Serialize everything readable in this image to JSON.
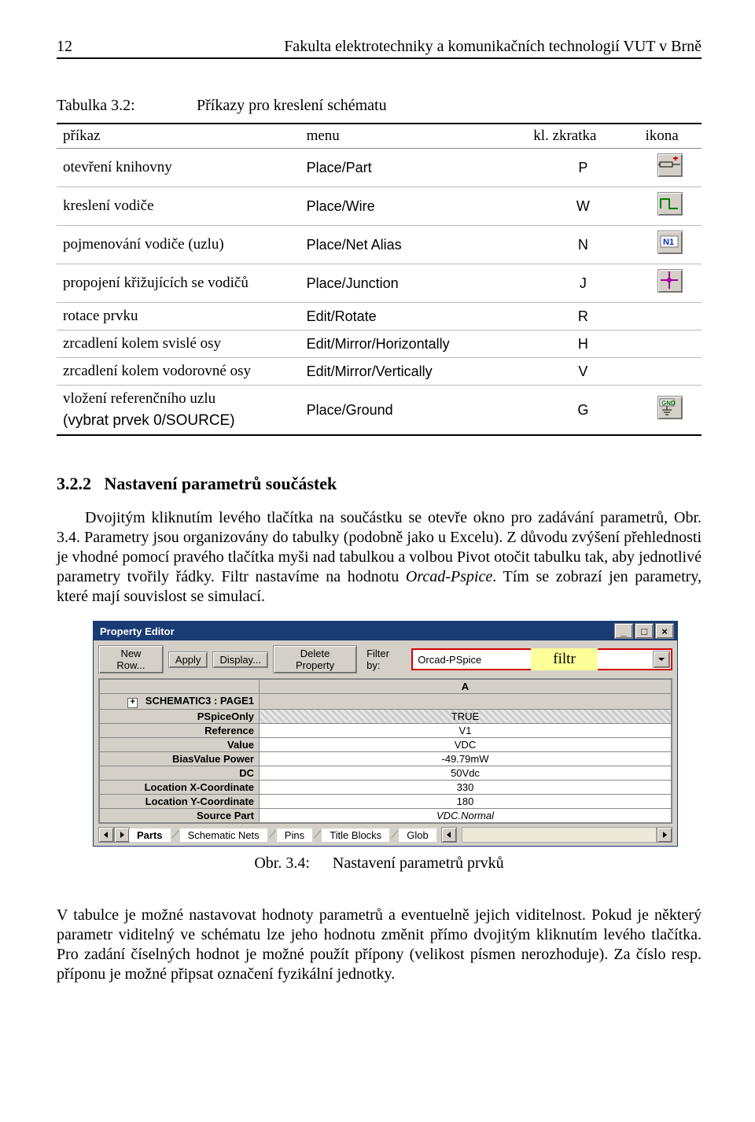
{
  "header": {
    "page": "12",
    "title": "Fakulta elektrotechniky a komunikačních technologií VUT v Brně"
  },
  "tablecaption": {
    "number": "Tabulka 3.2:",
    "text": "Příkazy pro kreslení schématu"
  },
  "tablehead": {
    "c1": "příkaz",
    "c2": "menu",
    "c3": "kl. zkratka",
    "c4": "ikona"
  },
  "rows": [
    {
      "prikaz": "otevření knihovny",
      "menu": "Place/Part",
      "zk": "P",
      "icon": "part"
    },
    {
      "prikaz": "kreslení vodiče",
      "menu": "Place/Wire",
      "zk": "W",
      "icon": "wire"
    },
    {
      "prikaz": "pojmenování vodiče (uzlu)",
      "menu": "Place/Net Alias",
      "zk": "N",
      "icon": "netalias"
    },
    {
      "prikaz": "propojení křižujících se vodičů",
      "menu": "Place/Junction",
      "zk": "J",
      "icon": "junction"
    },
    {
      "prikaz": "rotace prvku",
      "menu": "Edit/Rotate",
      "zk": "R",
      "icon": ""
    },
    {
      "prikaz": "zrcadlení kolem svislé osy",
      "menu": "Edit/Mirror/Horizontally",
      "zk": "H",
      "icon": ""
    },
    {
      "prikaz": "zrcadlení kolem vodorovné osy",
      "menu": "Edit/Mirror/Vertically",
      "zk": "V",
      "icon": ""
    },
    {
      "prikaz": "vložení referenčního uzlu",
      "menu": "Place/Ground",
      "zk": "G",
      "icon": "ground"
    }
  ],
  "source_note": "(vybrat prvek 0/SOURCE)",
  "section": {
    "number": "3.2.2",
    "title": "Nastavení parametrů součástek"
  },
  "para1": "Dvojitým kliknutím levého tlačítka na součástku se otevře okno pro zadávání parametrů, Obr. 3.4. Parametry jsou organizovány do tabulky (podobně jako u Excelu). Z důvodu zvýšení přehlednosti je vhodné pomocí pravého tlačítka myši nad tabulkou a volbou Pivot otočit tabulku tak, aby jednotlivé parametry tvořily řádky. Filtr nastavíme na hodnotu ",
  "para1_italic": "Orcad-Pspice",
  "para1_end": ". Tím se zobrazí jen parametry, které mají souvislost se simulací.",
  "pe": {
    "title": "Property Editor",
    "buttons": {
      "newrow": "New Row...",
      "apply": "Apply",
      "display": "Display...",
      "delete": "Delete Property"
    },
    "filter_by": "Filter by:",
    "combo": "Orcad-PSpice",
    "filtr_label": "filtr",
    "header_A": "A",
    "schematic": "SCHEMATIC3 : PAGE1",
    "grid": [
      {
        "label": "PSpiceOnly",
        "value": "TRUE",
        "hatched": true
      },
      {
        "label": "Reference",
        "value": "V1"
      },
      {
        "label": "Value",
        "value": "VDC"
      },
      {
        "label": "BiasValue Power",
        "value": "-49.79mW"
      },
      {
        "label": "DC",
        "value": "50Vdc"
      },
      {
        "label": "Location X-Coordinate",
        "value": "330"
      },
      {
        "label": "Location Y-Coordinate",
        "value": "180"
      },
      {
        "label": "Source Part",
        "value": "VDC.Normal",
        "italic": true
      }
    ],
    "tabs": {
      "parts": "Parts",
      "nets": "Schematic Nets",
      "pins": "Pins",
      "title": "Title Blocks",
      "glob": "Glob"
    }
  },
  "figcaption": {
    "num": "Obr. 3.4:",
    "text": "Nastavení parametrů prvků"
  },
  "para2": "V tabulce je možné nastavovat hodnoty parametrů a eventuelně jejich viditelnost. Pokud je některý parametr viditelný ve schématu lze jeho hodnotu změnit přímo dvojitým kliknutím levého tlačítka. Pro zadání číselných hodnot je možné použít přípony (velikost písmen nerozhoduje). Za číslo resp. příponu je možné připsat označení fyzikální jednotky."
}
